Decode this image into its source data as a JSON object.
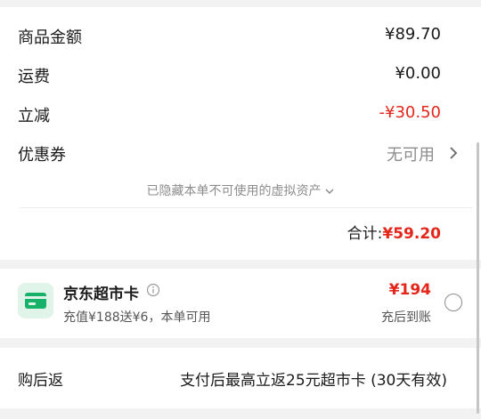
{
  "summary": {
    "rows": [
      {
        "label": "商品金额",
        "value": "¥89.70"
      },
      {
        "label": "运费",
        "value": "¥0.00"
      },
      {
        "label": "立减",
        "value": "-¥30.50"
      },
      {
        "label": "优惠券",
        "value": "无可用"
      }
    ],
    "hidden_assets_text": "已隐藏本单不可使用的虚拟资产",
    "total_label": "合计:",
    "total_value": "¥59.20"
  },
  "supermarket_card": {
    "title": "京东超市卡",
    "subtitle": "充值¥188送¥6，本单可用",
    "price": "¥194",
    "note": "充后到账"
  },
  "rebate": {
    "label": "购后返",
    "value": "支付后最高立返25元超市卡 (30天有效)"
  },
  "colors": {
    "accent_red": "#e4261b",
    "card_green": "#17b169"
  }
}
